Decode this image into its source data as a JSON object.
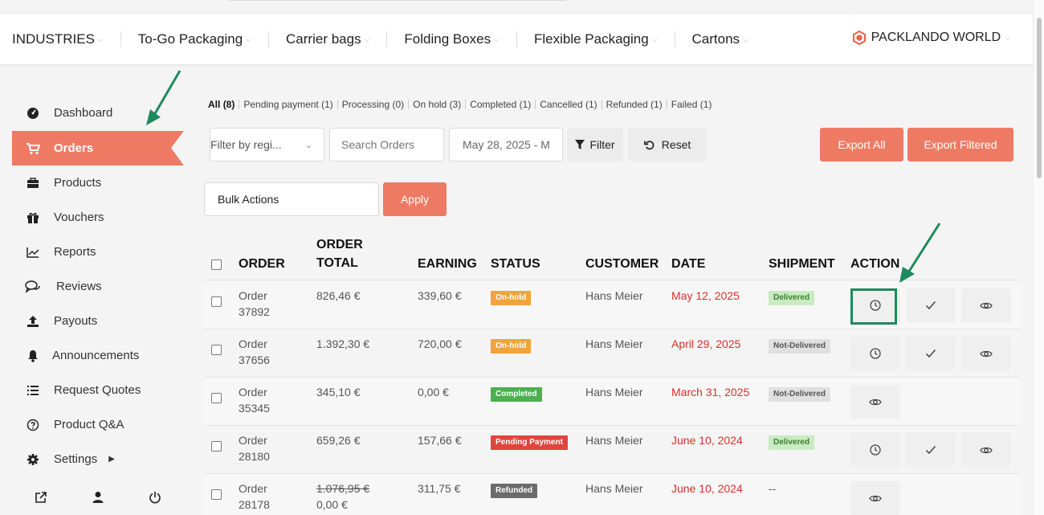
{
  "nav": {
    "items": [
      {
        "label": "INDUSTRIES"
      },
      {
        "label": "To-Go Packaging"
      },
      {
        "label": "Carrier bags"
      },
      {
        "label": "Folding Boxes"
      },
      {
        "label": "Flexible Packaging"
      },
      {
        "label": "Cartons"
      }
    ],
    "brand": "PACKLANDO WORLD"
  },
  "sidebar": {
    "items": [
      {
        "label": "Dashboard",
        "icon": "gauge-icon"
      },
      {
        "label": "Orders",
        "icon": "cart-icon",
        "active": true
      },
      {
        "label": "Products",
        "icon": "briefcase-icon"
      },
      {
        "label": "Vouchers",
        "icon": "gift-icon"
      },
      {
        "label": "Reports",
        "icon": "line-chart-icon"
      },
      {
        "label": "Reviews",
        "icon": "comments-icon"
      },
      {
        "label": "Payouts",
        "icon": "upload-icon"
      },
      {
        "label": "Announcements",
        "icon": "bell-icon"
      },
      {
        "label": "Request Quotes",
        "icon": "list-icon"
      },
      {
        "label": "Product Q&A",
        "icon": "question-icon"
      },
      {
        "label": "Settings",
        "icon": "cog-icon"
      }
    ]
  },
  "status_filters": [
    {
      "label": "All",
      "count": "(8)"
    },
    {
      "label": "Pending payment",
      "count": "(1)"
    },
    {
      "label": "Processing",
      "count": "(0)"
    },
    {
      "label": "On hold",
      "count": "(3)"
    },
    {
      "label": "Completed",
      "count": "(1)"
    },
    {
      "label": "Cancelled",
      "count": "(1)"
    },
    {
      "label": "Refunded",
      "count": "(1)"
    },
    {
      "label": "Failed",
      "count": "(1)"
    }
  ],
  "controls": {
    "filter_registered": "Filter by regi...",
    "search_placeholder": "Search Orders",
    "date_range": "May 28, 2025 - M",
    "filter_label": "Filter",
    "reset_label": "Reset",
    "export_all": "Export All",
    "export_filtered": "Export Filtered",
    "bulk_actions": "Bulk Actions",
    "apply": "Apply"
  },
  "table": {
    "headers": {
      "order": "ORDER",
      "order_total_1": "ORDER",
      "order_total_2": "TOTAL",
      "earning": "EARNING",
      "status": "STATUS",
      "customer": "CUSTOMER",
      "date": "DATE",
      "shipment": "SHIPMENT",
      "action": "ACTION"
    },
    "rows": [
      {
        "order_1": "Order",
        "order_2": "37892",
        "total": "826,46 €",
        "earning": "339,60 €",
        "status": "On-hold",
        "customer": "Hans Meier",
        "date": "May 12, 2025",
        "shipment": "Delivered"
      },
      {
        "order_1": "Order",
        "order_2": "37656",
        "total": "1.392,30 €",
        "earning": "720,00 €",
        "status": "On-hold",
        "customer": "Hans Meier",
        "date": "April 29, 2025",
        "shipment": "Not-Delivered"
      },
      {
        "order_1": "Order",
        "order_2": "35345",
        "total": "345,10 €",
        "earning": "0,00 €",
        "status": "Completed",
        "customer": "Hans Meier",
        "date": "March 31, 2025",
        "shipment": "Not-Delivered"
      },
      {
        "order_1": "Order",
        "order_2": "28180",
        "total": "659,26 €",
        "earning": "157,66 €",
        "status": "Pending Payment",
        "customer": "Hans Meier",
        "date": "June 10, 2024",
        "shipment": "Delivered"
      },
      {
        "order_1": "Order",
        "order_2": "28178",
        "total_old": "1.076,95 €",
        "total": "0,00 €",
        "earning": "311,75 €",
        "status": "Refunded",
        "customer": "Hans Meier",
        "date": "June 10, 2024",
        "shipment": "--"
      }
    ]
  },
  "colors": {
    "accent": "#ef7a63",
    "onhold": "#f0a439",
    "completed": "#4caf50",
    "pending": "#e0443e",
    "refunded": "#6b6b6b",
    "delivered_bg": "#c9ebc2",
    "delivered_fg": "#3b7f2f",
    "notdelivered_bg": "#e0e0e0",
    "notdelivered_fg": "#555555",
    "annotation": "#1f8a5e"
  }
}
